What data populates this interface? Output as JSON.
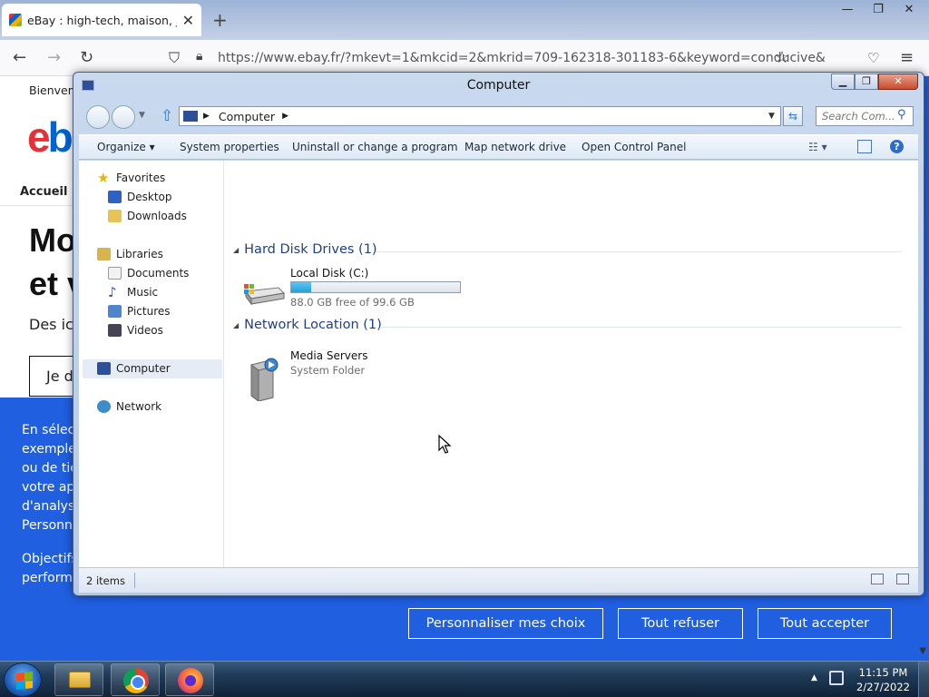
{
  "browser": {
    "tab_title": "eBay : high-tech, maison, jardin",
    "tab_close": "✕",
    "new_tab": "+",
    "url": "https://www.ebay.fr/?mkevt=1&mkcid=2&mkrid=709-162318-301183-6&keyword=conducive&",
    "win_min": "—",
    "win_max": "❐",
    "win_close": "✕"
  },
  "ebay": {
    "top_link": "Bienven",
    "logo_e": "e",
    "logo_b": "b",
    "nav_home": "Accueil",
    "headline_1": "Mo",
    "headline_2": "et v",
    "subline": "Des ic",
    "button_partial": "Je d",
    "cookie_lines": [
      "En sélect",
      "exemple,",
      "ou de tie",
      "votre app",
      "d'analyse",
      "Personna"
    ],
    "cookie_lines_2": [
      "Objectifs",
      "performa"
    ],
    "btn_customize": "Personnaliser mes choix",
    "btn_refuse": "Tout refuser",
    "btn_accept": "Tout accepter"
  },
  "explorer": {
    "title": "Computer",
    "address_path": "Computer",
    "search_placeholder": "Search Com...",
    "commands": {
      "organize": "Organize ▾",
      "system_properties": "System properties",
      "uninstall": "Uninstall or change a program",
      "map_drive": "Map network drive",
      "control_panel": "Open Control Panel"
    },
    "nav_pane": {
      "favorites": "Favorites",
      "desktop": "Desktop",
      "downloads": "Downloads",
      "libraries": "Libraries",
      "documents": "Documents",
      "music": "Music",
      "pictures": "Pictures",
      "videos": "Videos",
      "computer": "Computer",
      "network": "Network"
    },
    "groups": {
      "hdd_header": "Hard Disk Drives (1)",
      "net_header": "Network Location (1)"
    },
    "drive": {
      "name": "Local Disk (C:)",
      "free_text": "88.0 GB free of 99.6 GB",
      "used_fraction": 0.12
    },
    "network_item": {
      "name": "Media Servers",
      "type": "System Folder"
    },
    "status_count": "2 items"
  },
  "taskbar": {
    "time": "11:15 PM",
    "date": "2/27/2022"
  }
}
